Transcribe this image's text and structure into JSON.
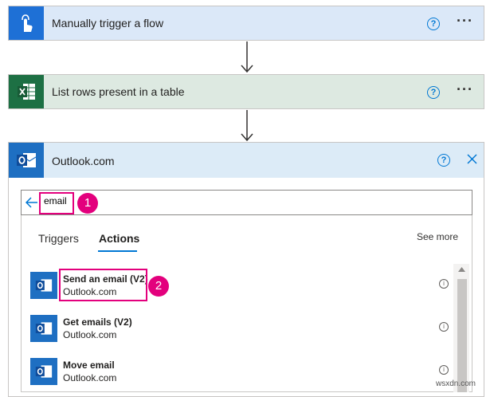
{
  "steps": [
    {
      "title": "Manually trigger a flow",
      "icon": "touch-icon",
      "color": "#1e70d6"
    },
    {
      "title": "List rows present in a table",
      "icon": "excel-icon",
      "color": "#1d7044"
    }
  ],
  "connector": {
    "title": "Outlook.com",
    "search_value": "email",
    "tabs": [
      "Triggers",
      "Actions"
    ],
    "active_tab": "Actions",
    "see_more": "See more",
    "actions": [
      {
        "name": "Send an email (V2)",
        "source": "Outlook.com"
      },
      {
        "name": "Get emails (V2)",
        "source": "Outlook.com"
      },
      {
        "name": "Move email",
        "source": "Outlook.com"
      }
    ]
  },
  "callouts": [
    "1",
    "2"
  ],
  "help_symbol": "?",
  "more_symbol": "···",
  "watermark": "wsxdn.com",
  "colors": {
    "accent": "#0078d4",
    "callout": "#e3007d",
    "excel_bg": "#dde9e1",
    "header_bg": "#dcebf7"
  }
}
